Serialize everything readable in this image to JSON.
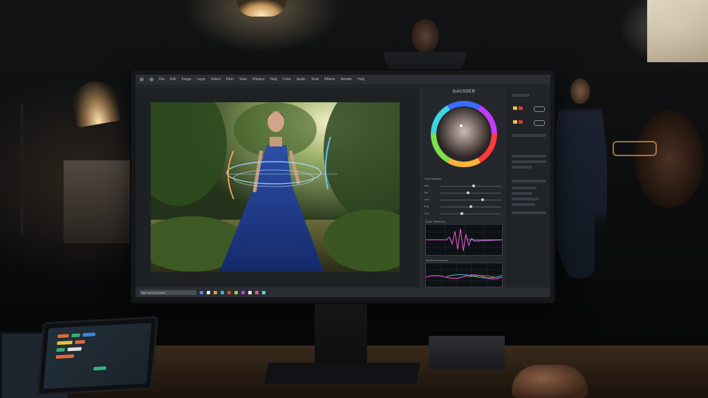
{
  "scene": {
    "description_visible_text": false
  },
  "app": {
    "menu_items": [
      "File",
      "Edit",
      "Image",
      "Layer",
      "Select",
      "Filter",
      "View",
      "Window",
      "Help",
      "Color",
      "Audio",
      "Tools",
      "Effects",
      "Render",
      "Help"
    ],
    "panel_title": "GAUSSER",
    "taskbar_search": "Type here to search",
    "slider_labels": [
      "Hue",
      "Sat",
      "Lum",
      "Exp",
      "Con"
    ],
    "slider_values": [
      0.55,
      0.45,
      0.7,
      0.5,
      0.35
    ],
    "scope1_label": "Audio Waveform",
    "scope2_label": "Spectrum Analyzer",
    "section_label": "Color Balance"
  },
  "colors": {
    "accent_wave": "#d94fc4",
    "accent_cyan": "#4fd2e6",
    "dress": "#1f3c8a",
    "hologram": "#9fd3ff"
  }
}
